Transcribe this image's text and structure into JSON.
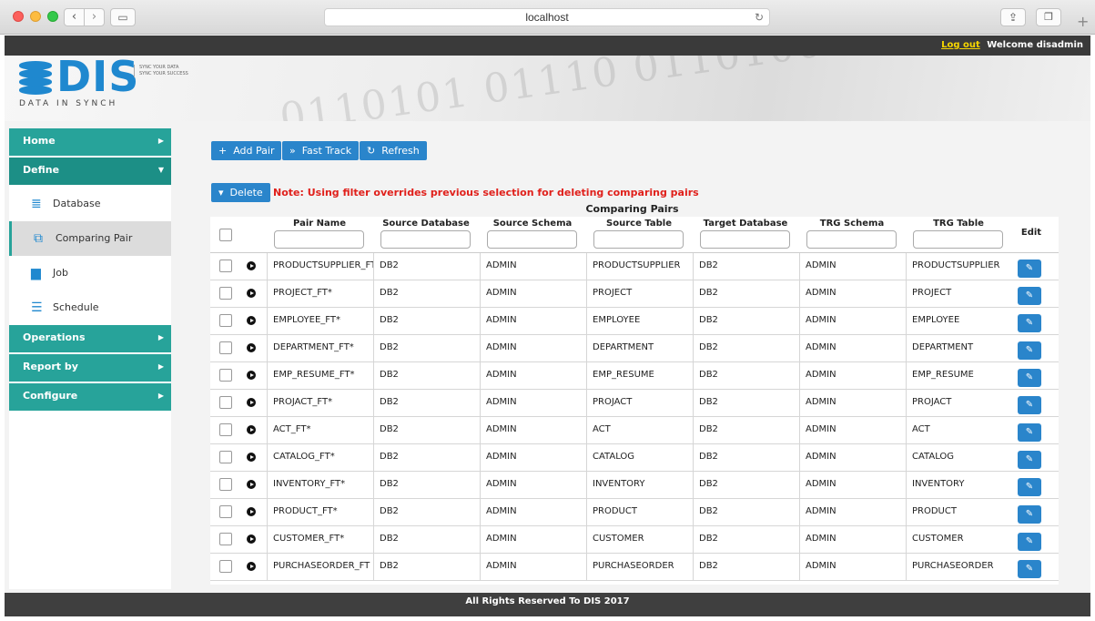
{
  "browser": {
    "url": "localhost"
  },
  "topbar": {
    "logout": "Log out",
    "welcome": "Welcome disadmin"
  },
  "brand": {
    "name": "DIS",
    "subtitle": "DATA IN SYNCH",
    "tag1": "SYNC YOUR DATA",
    "tag2": "SYNC YOUR SUCCESS"
  },
  "sidebar": {
    "home": "Home",
    "define": "Define",
    "define_items": [
      "Database",
      "Comparing Pair",
      "Job",
      "Schedule"
    ],
    "operations": "Operations",
    "report": "Report by",
    "configure": "Configure"
  },
  "toolbar": {
    "add": "Add Pair",
    "fast": "Fast Track",
    "refresh": "Refresh",
    "delete": "Delete"
  },
  "note": "Note: Using filter overrides previous selection for deleting comparing pairs",
  "table": {
    "title": "Comparing Pairs",
    "headers": [
      "Pair Name",
      "Source Database",
      "Source Schema",
      "Source Table",
      "Target Database",
      "TRG Schema",
      "TRG Table",
      "Edit"
    ],
    "rows": [
      [
        "PRODUCTSUPPLIER_FT",
        "DB2",
        "ADMIN",
        "PRODUCTSUPPLIER",
        "DB2",
        "ADMIN",
        "PRODUCTSUPPLIER"
      ],
      [
        "PROJECT_FT*",
        "DB2",
        "ADMIN",
        "PROJECT",
        "DB2",
        "ADMIN",
        "PROJECT"
      ],
      [
        "EMPLOYEE_FT*",
        "DB2",
        "ADMIN",
        "EMPLOYEE",
        "DB2",
        "ADMIN",
        "EMPLOYEE"
      ],
      [
        "DEPARTMENT_FT*",
        "DB2",
        "ADMIN",
        "DEPARTMENT",
        "DB2",
        "ADMIN",
        "DEPARTMENT"
      ],
      [
        "EMP_RESUME_FT*",
        "DB2",
        "ADMIN",
        "EMP_RESUME",
        "DB2",
        "ADMIN",
        "EMP_RESUME"
      ],
      [
        "PROJACT_FT*",
        "DB2",
        "ADMIN",
        "PROJACT",
        "DB2",
        "ADMIN",
        "PROJACT"
      ],
      [
        "ACT_FT*",
        "DB2",
        "ADMIN",
        "ACT",
        "DB2",
        "ADMIN",
        "ACT"
      ],
      [
        "CATALOG_FT*",
        "DB2",
        "ADMIN",
        "CATALOG",
        "DB2",
        "ADMIN",
        "CATALOG"
      ],
      [
        "INVENTORY_FT*",
        "DB2",
        "ADMIN",
        "INVENTORY",
        "DB2",
        "ADMIN",
        "INVENTORY"
      ],
      [
        "PRODUCT_FT*",
        "DB2",
        "ADMIN",
        "PRODUCT",
        "DB2",
        "ADMIN",
        "PRODUCT"
      ],
      [
        "CUSTOMER_FT*",
        "DB2",
        "ADMIN",
        "CUSTOMER",
        "DB2",
        "ADMIN",
        "CUSTOMER"
      ],
      [
        "PURCHASEORDER_FT",
        "DB2",
        "ADMIN",
        "PURCHASEORDER",
        "DB2",
        "ADMIN",
        "PURCHASEORDER"
      ]
    ]
  },
  "footer": "All Rights Reserved To DIS 2017",
  "colors": {
    "teal": "#27a39a",
    "blue": "#2a85cb",
    "note_red": "#e0201b"
  }
}
